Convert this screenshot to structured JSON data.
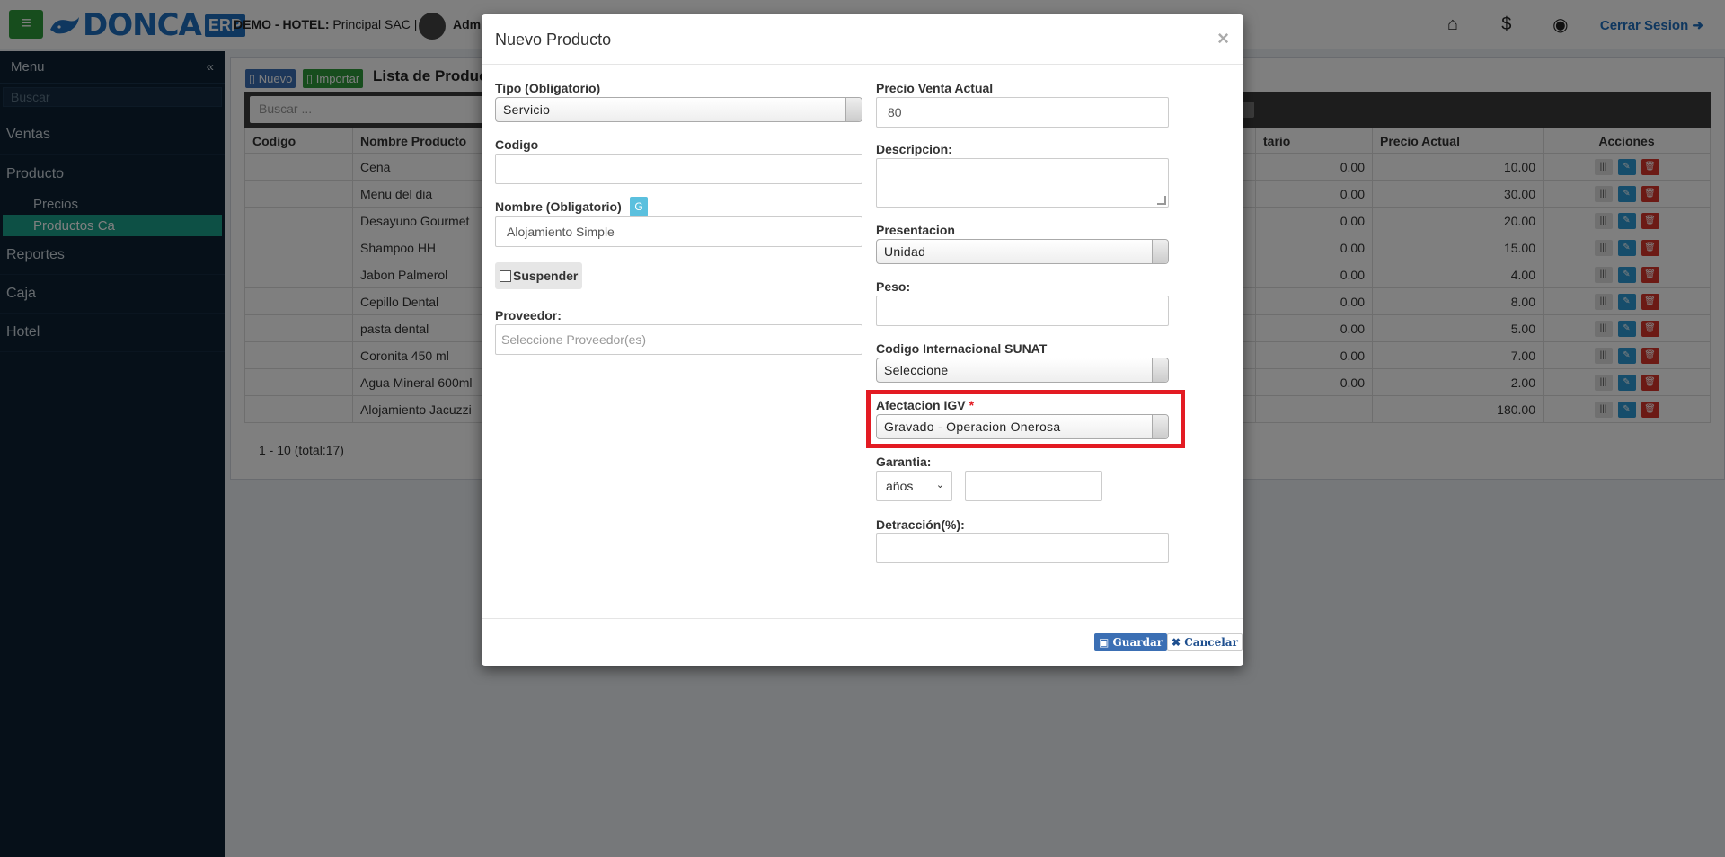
{
  "topbar": {
    "logo_text": "DONCA",
    "logo_badge": "ERP",
    "company_bold": "DEMO - HOTEL:",
    "company_name": " Principal SAC |",
    "user_name": "Adm",
    "logout_label": "Cerrar Sesion"
  },
  "sidebar": {
    "title": "Menu",
    "collapse_glyph": "«",
    "search_placeholder": "Buscar",
    "items": [
      {
        "label": "Ventas"
      },
      {
        "label": "Producto"
      },
      {
        "label": "Reportes"
      },
      {
        "label": "Caja"
      },
      {
        "label": "Hotel"
      }
    ],
    "subitems": [
      {
        "label": "Precios"
      },
      {
        "label": "Productos Ca"
      }
    ]
  },
  "content": {
    "nuevo_label": "Nuevo",
    "importar_label": "Importar",
    "list_title": "Lista de Produc",
    "search_placeholder": "Buscar ...",
    "columns": {
      "codigo": "Codigo",
      "nombre": "Nombre Producto",
      "unitario": "tario",
      "precio": "Precio Actual",
      "acciones": "Acciones"
    },
    "rows": [
      {
        "name": "Cena",
        "unit": "0.00",
        "price": "10.00"
      },
      {
        "name": "Menu del dia",
        "unit": "0.00",
        "price": "30.00"
      },
      {
        "name": "Desayuno Gourmet",
        "unit": "0.00",
        "price": "20.00"
      },
      {
        "name": "Shampoo HH",
        "unit": "0.00",
        "price": "15.00"
      },
      {
        "name": "Jabon Palmerol",
        "unit": "0.00",
        "price": "4.00"
      },
      {
        "name": "Cepillo Dental",
        "unit": "0.00",
        "price": "8.00"
      },
      {
        "name": "pasta dental",
        "unit": "0.00",
        "price": "5.00"
      },
      {
        "name": "Coronita 450 ml",
        "unit": "0.00",
        "price": "7.00"
      },
      {
        "name": "Agua Mineral 600ml",
        "unit": "0.00",
        "price": "2.00"
      },
      {
        "name": "Alojamiento Jacuzzi",
        "unit": "",
        "price": "180.00"
      }
    ],
    "pager": "1 - 10 (total:17)"
  },
  "modal": {
    "title": "Nuevo Producto",
    "close_glyph": "×",
    "tipo_label": "Tipo (Obligatorio)",
    "tipo_value": "Servicio",
    "codigo_label": "Codigo",
    "codigo_value": "",
    "nombre_label": "Nombre (Obligatorio)",
    "nombre_btn": "G",
    "nombre_value": "Alojamiento Simple",
    "suspender_label": "Suspender",
    "proveedor_label": "Proveedor:",
    "proveedor_placeholder": "Seleccione Proveedor(es)",
    "precio_label": "Precio Venta Actual",
    "precio_value": "80",
    "descripcion_label": "Descripcion:",
    "presentacion_label": "Presentacion",
    "presentacion_value": "Unidad",
    "peso_label": "Peso:",
    "peso_value": "",
    "sunat_label": "Codigo Internacional SUNAT",
    "sunat_value": "Seleccione",
    "igv_label": "Afectacion IGV",
    "igv_required": "*",
    "igv_value": "Gravado - Operacion Onerosa",
    "garantia_label": "Garantia:",
    "garantia_unit": "años",
    "garantia_value": "",
    "detraccion_label": "Detracción(%):",
    "detraccion_value": "",
    "save_label": "Guardar",
    "cancel_label": "Cancelar"
  },
  "colors": {
    "accent": "#1e6fbf",
    "highlight": "#e31b23",
    "sidebar_active": "#1aa08a"
  }
}
